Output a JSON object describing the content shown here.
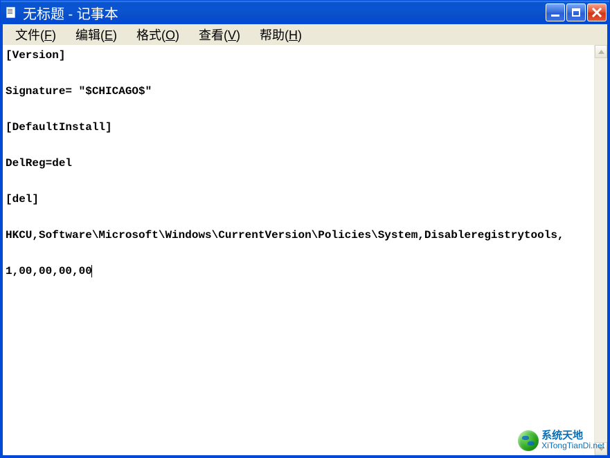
{
  "window": {
    "title": "无标题 - 记事本"
  },
  "menu": {
    "file": {
      "label": "文件",
      "accel": "F"
    },
    "edit": {
      "label": "编辑",
      "accel": "E"
    },
    "format": {
      "label": "格式",
      "accel": "O"
    },
    "view": {
      "label": "查看",
      "accel": "V"
    },
    "help": {
      "label": "帮助",
      "accel": "H"
    }
  },
  "editor": {
    "content": "[Version]\n\nSignature= \"$CHICAGO$\"\n\n[DefaultInstall]\n\nDelReg=del\n\n[del]\n\nHKCU,Software\\Microsoft\\Windows\\CurrentVersion\\Policies\\System,Disableregistrytools,\n\n1,00,00,00,00"
  },
  "watermark": {
    "title": "系统天地",
    "url": "XiTongTianDi.net"
  }
}
